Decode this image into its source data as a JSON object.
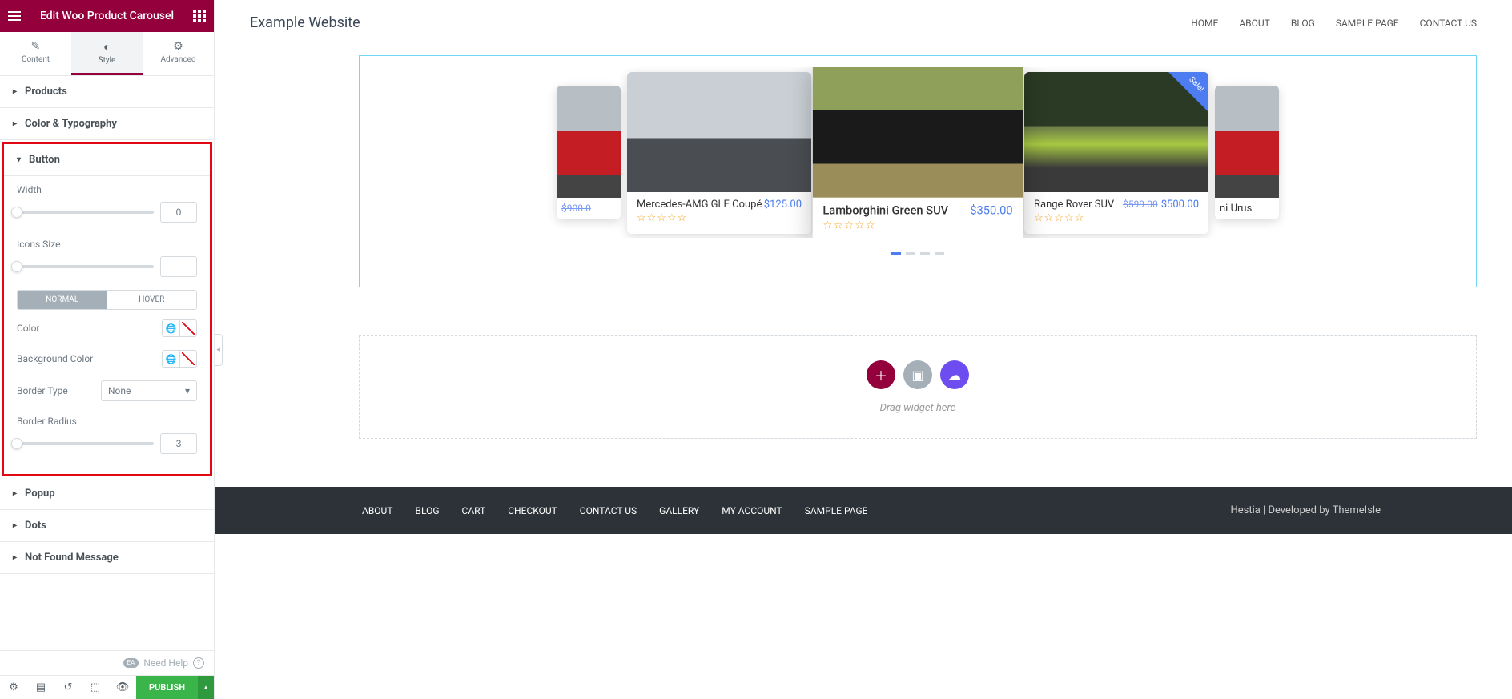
{
  "header": {
    "title": "Edit Woo Product Carousel"
  },
  "tabs": {
    "content": "Content",
    "style": "Style",
    "advanced": "Advanced"
  },
  "sections": {
    "products": "Products",
    "color_typography": "Color & Typography",
    "button": "Button",
    "popup": "Popup",
    "dots": "Dots",
    "not_found": "Not Found Message"
  },
  "controls": {
    "width": {
      "label": "Width",
      "value": "0"
    },
    "icons_size": {
      "label": "Icons Size",
      "value": ""
    },
    "states": {
      "normal": "NORMAL",
      "hover": "HOVER"
    },
    "color": {
      "label": "Color"
    },
    "bgcolor": {
      "label": "Background Color"
    },
    "border_type": {
      "label": "Border Type",
      "value": "None"
    },
    "border_radius": {
      "label": "Border Radius",
      "value": "3"
    }
  },
  "footer": {
    "need_help": "Need Help",
    "ea": "EA",
    "publish": "PUBLISH"
  },
  "site": {
    "title": "Example Website",
    "nav": [
      "HOME",
      "ABOUT",
      "BLOG",
      "SAMPLE PAGE",
      "CONTACT US"
    ]
  },
  "carousel": {
    "products": [
      {
        "name": "",
        "price_old": "$900.0",
        "price": ""
      },
      {
        "name": "Mercedes-AMG GLE Coupé",
        "price": "$125.00"
      },
      {
        "name": "Lamborghini Green SUV",
        "price": "$350.00"
      },
      {
        "name": "Range Rover SUV",
        "price_old": "$599.00",
        "price": "$500.00",
        "sale": "Sale!"
      },
      {
        "name": "ni Urus",
        "price": ""
      }
    ]
  },
  "dropzone": {
    "text": "Drag widget here"
  },
  "footer_nav": [
    "ABOUT",
    "BLOG",
    "CART",
    "CHECKOUT",
    "CONTACT US",
    "GALLERY",
    "MY ACCOUNT",
    "SAMPLE PAGE"
  ],
  "footer_credit": "Hestia | Developed by ThemeIsle",
  "colors": {
    "dz_plus": "#93003c",
    "dz_folder": "#a4afb7",
    "dz_cloud": "#6e4df0"
  }
}
